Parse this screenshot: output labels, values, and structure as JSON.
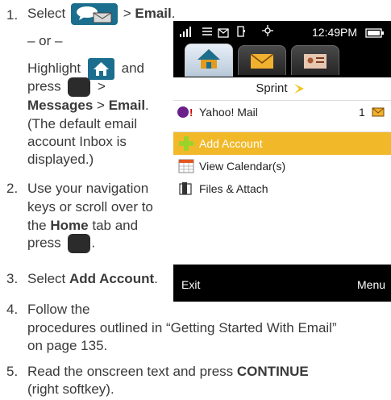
{
  "steps": {
    "s1": {
      "num": "1.",
      "select": "Select",
      "arrow1": ">",
      "email": "Email",
      "period1": ".",
      "or": "– or –",
      "highlight": "Highlight",
      "and": "and",
      "press": "press",
      "arrow2": ">",
      "messages": "Messages",
      "arrow3": ">",
      "email2": "Email",
      "period2": ".",
      "note_l1": "(The default email",
      "note_l2": "account Inbox is",
      "note_l3": "displayed.)"
    },
    "s2": {
      "num": "2.",
      "l1": "Use your navigation",
      "l2": "keys or scroll over to",
      "l3a": "the",
      "home": "Home",
      "l3b": "tab and",
      "press": "press",
      "period": "."
    },
    "s3": {
      "num": "3.",
      "select": "Select",
      "target": "Add Account",
      "period": "."
    },
    "s4": {
      "num": "4.",
      "l1": "Follow the",
      "l2": "procedures outlined in “Getting Started With Email”",
      "l3": "on page 135."
    },
    "s5": {
      "num": "5.",
      "l1a": "Read the onscreen text and press",
      "continue": "CONTINUE",
      "l2": "(right softkey)."
    }
  },
  "phone": {
    "time": "12:49PM",
    "carrier": "Sprint",
    "rows": [
      {
        "label": "Yahoo! Mail",
        "count": "1"
      },
      {
        "label": "Add Account"
      },
      {
        "label": "View Calendar(s)"
      },
      {
        "label": "Files & Attach"
      }
    ],
    "softkey_left": "Exit",
    "softkey_right": "Menu"
  }
}
